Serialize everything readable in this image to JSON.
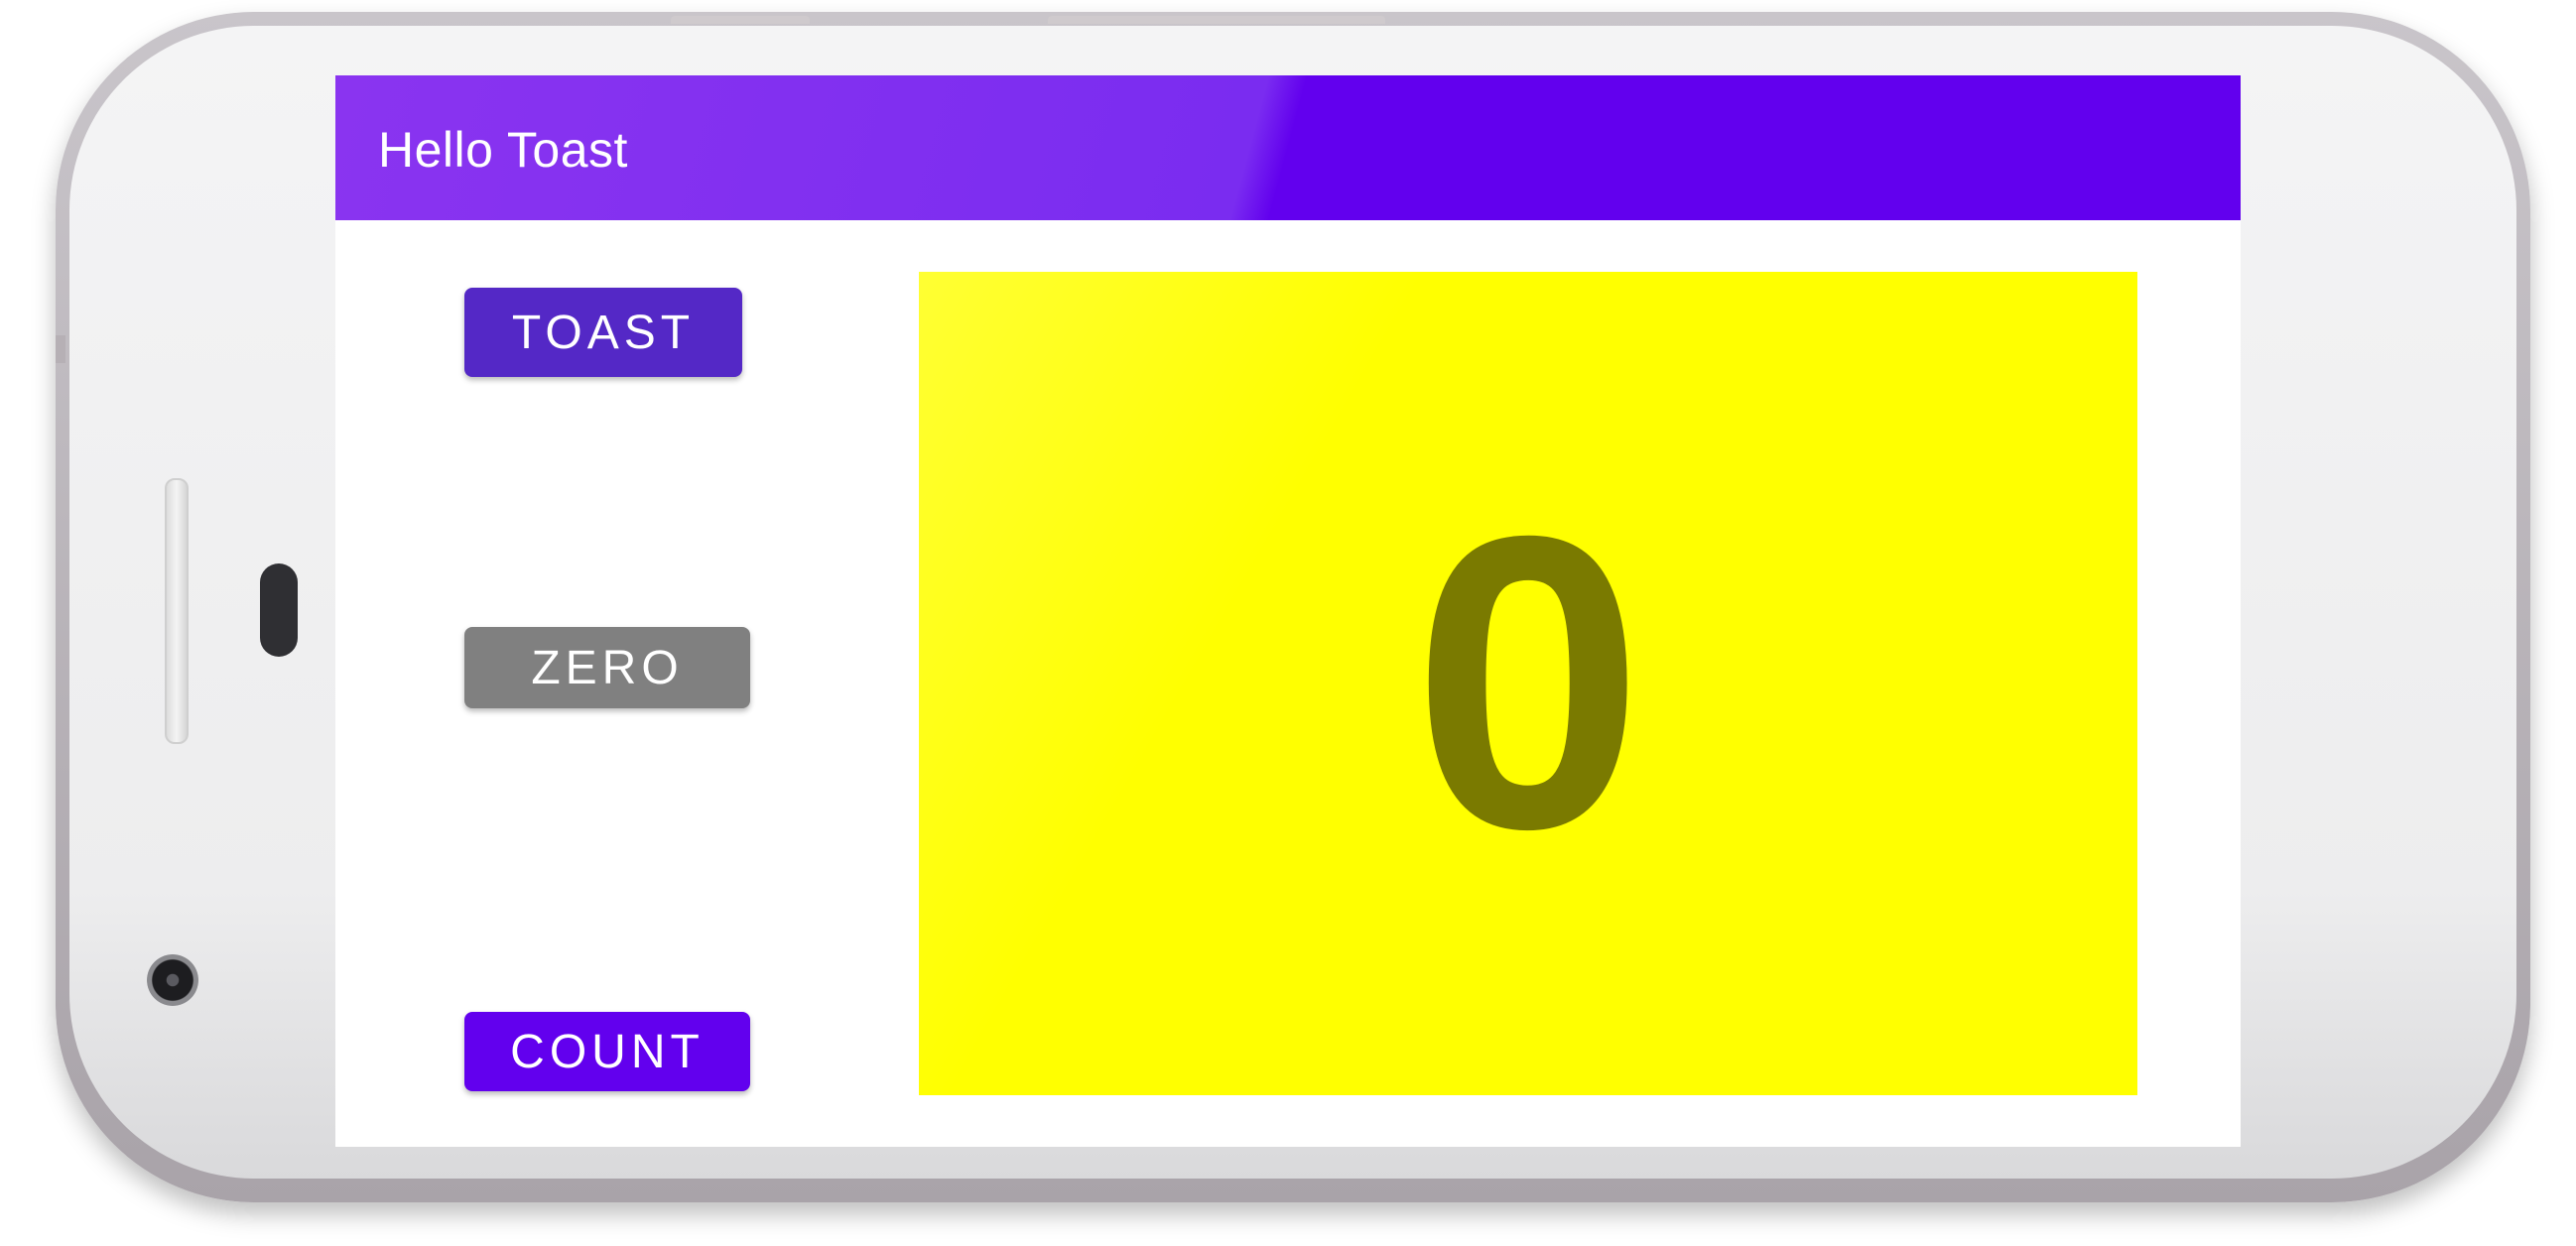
{
  "app": {
    "title": "Hello Toast"
  },
  "buttons": {
    "toast_label": "TOAST",
    "zero_label": "ZERO",
    "count_label": "COUNT"
  },
  "counter": {
    "value": "0"
  },
  "colors": {
    "app_bar": "#6200ee",
    "toast_button": "#5428c6",
    "zero_button": "#808080",
    "count_button": "#6200ee",
    "count_background": "#ffff00",
    "count_text": "#7a7a00"
  }
}
